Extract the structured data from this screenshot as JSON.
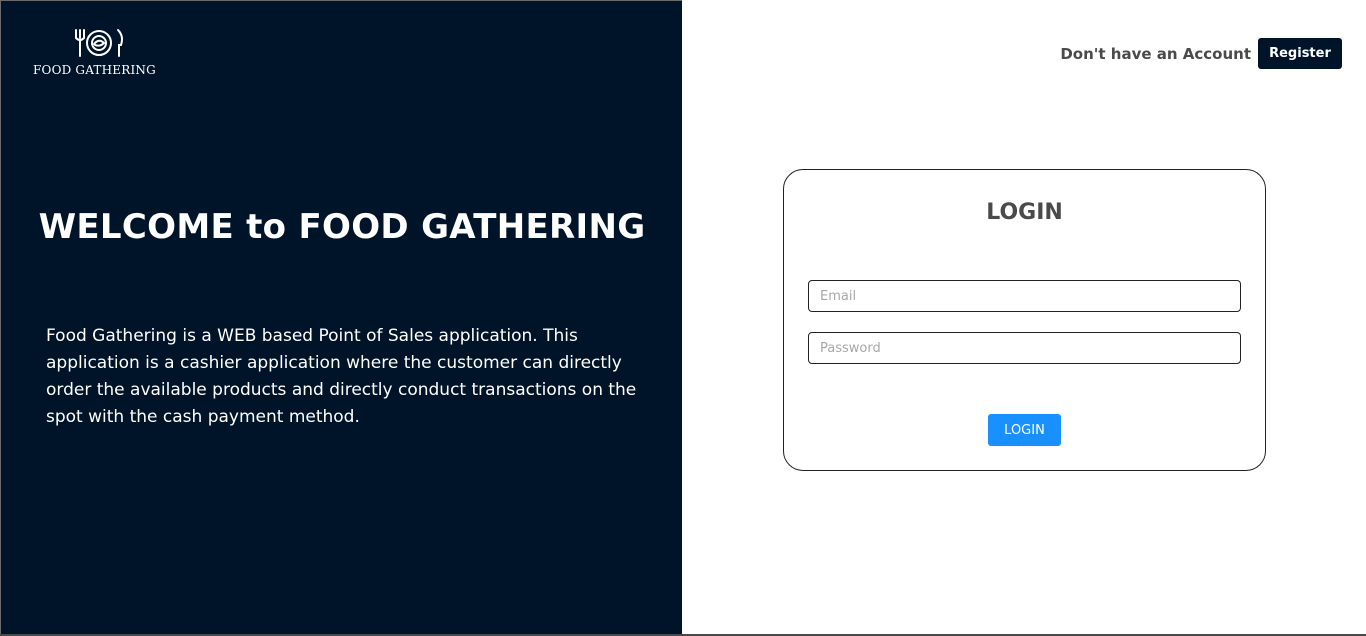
{
  "brand": {
    "logo_icon": "plate-fork-knife-icon",
    "logo_text": "FOOD GATHERING"
  },
  "hero": {
    "title": "WELCOME to FOOD GATHERING",
    "description": "Food Gathering is a WEB based Point of Sales application. This application is a cashier application where the customer can directly order the available products and directly conduct transactions on the spot with the cash payment method."
  },
  "header": {
    "account_prompt": "Don't have an Account",
    "register_label": "Register"
  },
  "login": {
    "title": "LOGIN",
    "email_placeholder": "Email",
    "email_value": "",
    "password_placeholder": "Password",
    "password_value": "",
    "submit_label": "LOGIN"
  },
  "colors": {
    "panel_background": "#001429",
    "accent": "#1890ff",
    "register_button": "#001429"
  }
}
